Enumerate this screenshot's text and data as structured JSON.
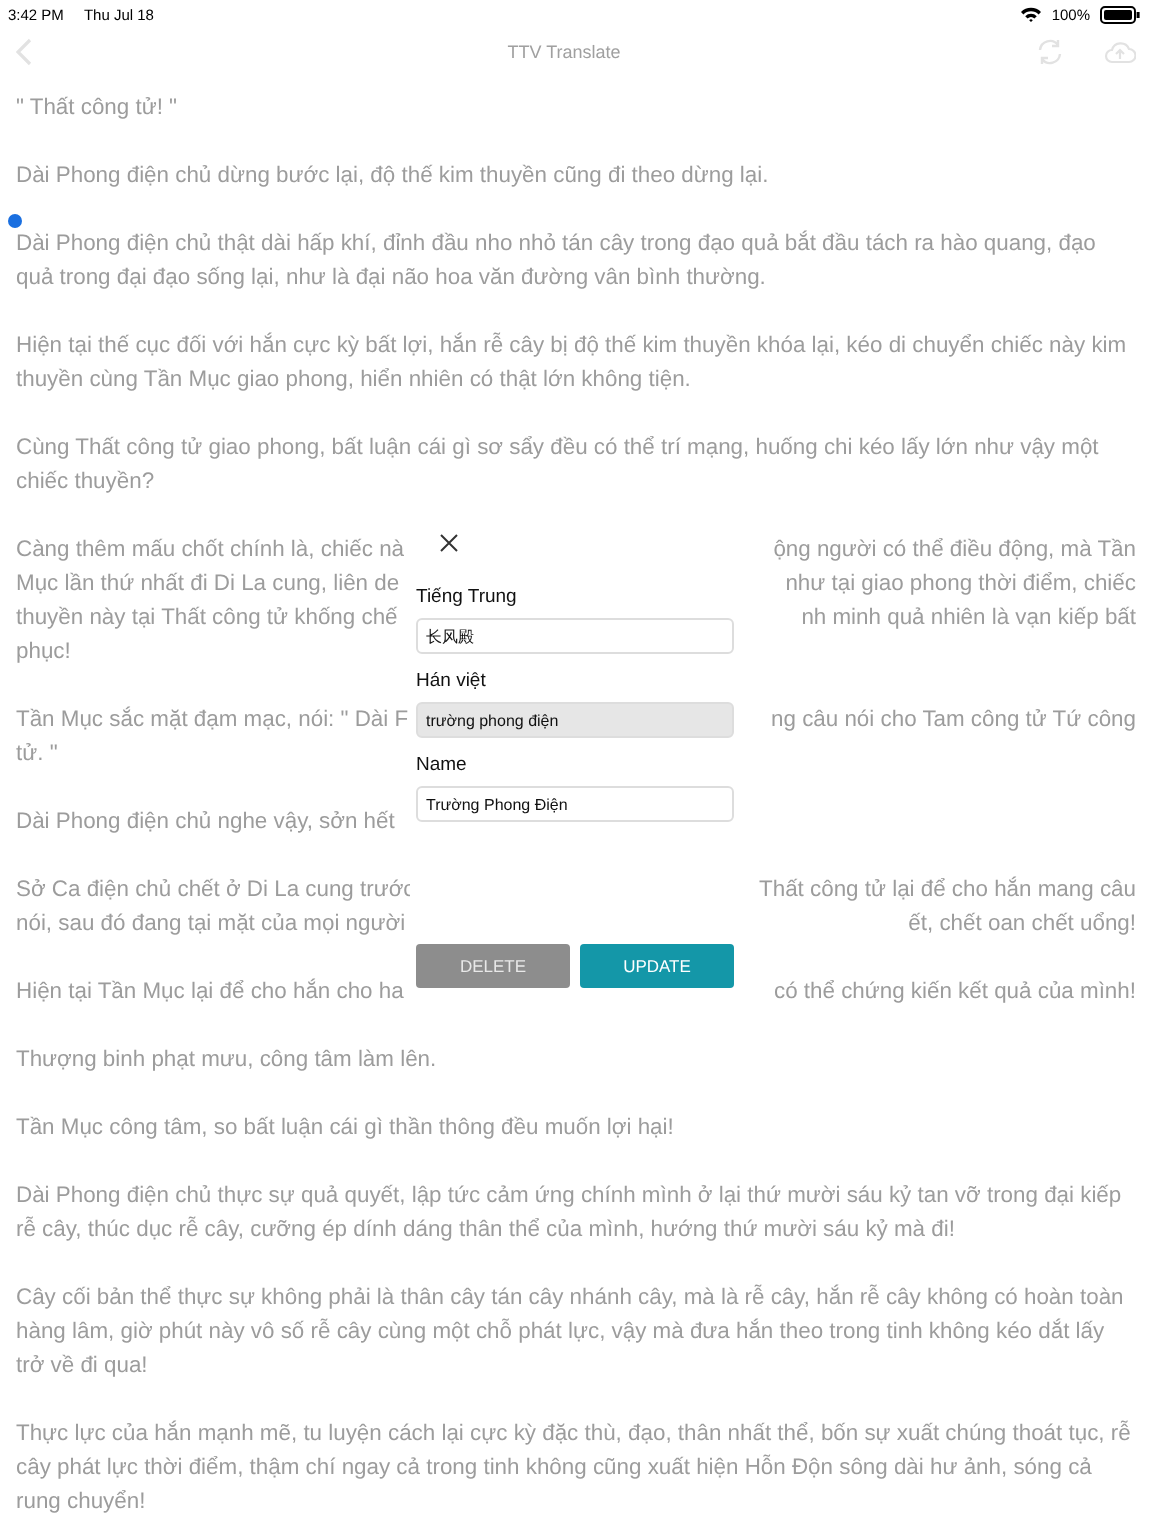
{
  "status_bar": {
    "time": "3:42 PM",
    "date": "Thu Jul 18",
    "battery": "100%"
  },
  "nav": {
    "title": "TTV Translate"
  },
  "paragraphs": [
    {
      "text": "\" Thất công tử! \""
    },
    {
      "text": "Dài Phong điện chủ dừng bước lại, độ thế kim thuyền cũng đi theo dừng lại."
    },
    {
      "text": "Dài Phong điện chủ thật dài hấp khí, đỉnh đầu nho nhỏ tán cây trong đạo quả bắt đầu tách ra hào quang, đạo quả trong đại đạo sống lại, như là đại não hoa văn đường vân bình thường.",
      "selection": true
    },
    {
      "text": "Hiện tại thế cục đối với hắn cực kỳ bất lợi, hắn rễ cây bị độ thế kim thuyền khóa lại, kéo di chuyển chiếc này kim thuyền cùng Tần Mục giao phong, hiển nhiên có thật lớn không tiện."
    },
    {
      "text": "Cùng Thất công tử giao phong, bất luận cái gì sơ sẩy đều có thể trí mạng, huống chi kéo lấy lớn như vậy một chiếc thuyền?"
    },
    {
      "lines": [
        {
          "left": "Càng thêm mấu chốt chính là, chiếc nà",
          "right": "ộng người có thể điều động, mà Tần"
        },
        {
          "left": "Mục lần thứ nhất đi Di La cung, liên de",
          "right": "như tại giao phong thời điểm, chiếc"
        },
        {
          "left": "thuyền này tại Thất công tử khống chế",
          "right": "nh minh quả nhiên là vạn kiếp bất"
        },
        {
          "left": "phục!"
        }
      ]
    },
    {
      "lines": [
        {
          "left": "Tần Mục sắc mặt đạm mạc, nói: \" Dài F",
          "right": "ng câu nói cho Tam công tử Tứ công"
        },
        {
          "left": "tử. \""
        }
      ]
    },
    {
      "lines": [
        {
          "left": "Dài Phong điện chủ nghe vậy, sởn hết"
        }
      ]
    },
    {
      "lines": [
        {
          "left": "Sở Ca điện chủ chết ở Di La cung trước",
          "right": "Thất công tử lại để cho hắn mang câu"
        },
        {
          "left": "nói, sau đó đang tại mặt của mọi người",
          "right": "ết, chết oan chết uổng!"
        }
      ]
    },
    {
      "lines": [
        {
          "left": "Hiện tại Tần Mục lại để cho hắn cho ha",
          "right": "có thể chứng kiến kết quả của mình!"
        }
      ]
    },
    {
      "text": "Thượng binh phạt mưu, công tâm làm lên."
    },
    {
      "text": "Tần Mục công tâm, so bất luận cái gì thần thông đều muốn lợi hại!"
    },
    {
      "text": "Dài Phong điện chủ thực sự quả quyết, lập tức cảm ứng chính mình ở lại thứ mười sáu kỷ tan vỡ trong đại kiếp rễ cây, thúc dục rễ cây, cưỡng ép dính dáng thân thể của mình, hướng thứ mười sáu kỷ mà đi!"
    },
    {
      "text": "Cây cối bản thể thực sự không phải là thân cây tán cây nhánh cây, mà là rễ cây, hắn rễ cây không có hoàn toàn hàng lâm, giờ phút này vô số rễ cây cùng một chỗ phát lực, vậy mà đưa hắn theo trong tinh không kéo dắt lấy trở về đi qua!"
    },
    {
      "text": "Thực lực của hắn mạnh mẽ, tu luyện cách lại cực kỳ đặc thù, đạo, thân nhất thể, bốn sự xuất chúng thoát tục, rễ cây phát lực thời điểm, thậm chí ngay cả trong tinh không cũng xuất hiện Hỗn Độn sông dài hư ảnh, sóng cả rung chuyển!"
    }
  ],
  "dialog": {
    "fields": [
      {
        "label": "Tiếng Trung",
        "value": "长风殿",
        "disabled": false
      },
      {
        "label": "Hán việt",
        "value": "trường phong điện",
        "disabled": true
      },
      {
        "label": "Name",
        "value": "Trường Phong Điện",
        "disabled": false
      }
    ],
    "buttons": [
      {
        "label": "DELETE",
        "kind": "secondary"
      },
      {
        "label": "UPDATE",
        "kind": "primary"
      }
    ]
  }
}
